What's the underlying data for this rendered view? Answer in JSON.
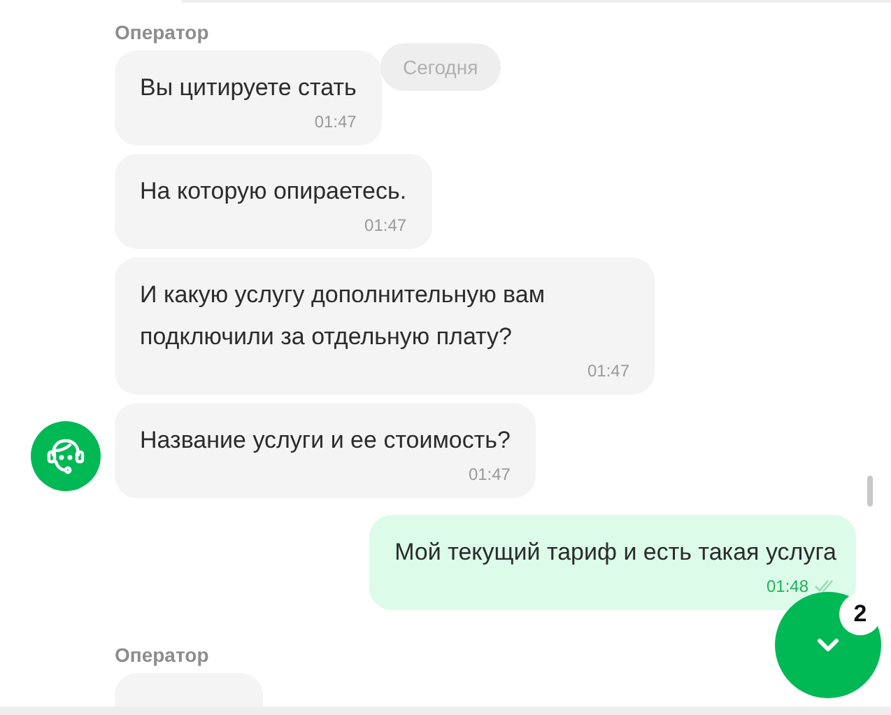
{
  "date_chip": "Сегодня",
  "groups": [
    {
      "sender": "Оператор",
      "outgoing": false,
      "avatar": true,
      "messages": [
        {
          "text": "Вы цитируете стать",
          "time": "01:47"
        },
        {
          "text": "На которую опираетесь.",
          "time": "01:47"
        },
        {
          "text": "И какую услугу дополнительную вам подключили за отдельную плату?",
          "time": "01:47"
        },
        {
          "text": "Название услуги и ее стоимость?",
          "time": "01:47"
        }
      ]
    },
    {
      "outgoing": true,
      "messages": [
        {
          "text": "Мой текущий тариф и есть такая услуга",
          "time": "01:48",
          "read": true
        }
      ]
    },
    {
      "sender": "Оператор",
      "outgoing": false,
      "cut_off": true
    }
  ],
  "scroll_button": {
    "badge": "2"
  }
}
